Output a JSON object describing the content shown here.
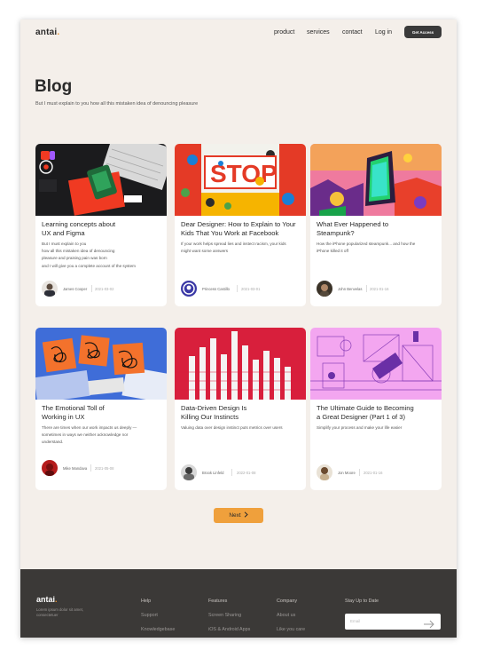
{
  "header": {
    "logo": "antai",
    "logo_dot": ".",
    "nav": [
      "product",
      "services",
      "contact",
      "Log in"
    ],
    "cta": "Get Access"
  },
  "hero": {
    "title": "Blog",
    "subtitle": "But I must explain to you how all this mistaken idea of denouncing pleasure"
  },
  "posts": [
    {
      "title_lines": [
        "Learning concepts about",
        "UX and Figma"
      ],
      "excerpt_lines": [
        "But I must explain to you",
        "how all this mistaken idea of denouncing",
        "pleasure and praising pain was born",
        "and I will give you a complete account of the system"
      ],
      "author": "James Cooper",
      "date": "2021-03-02"
    },
    {
      "title_lines": [
        "Dear Designer: How to Explain to Your",
        "Kids That You Work at Facebook"
      ],
      "excerpt_lines": [
        "If your work helps spread lies and instect racism, your kids",
        "might want some answers"
      ],
      "author": "Princess Castillo",
      "date": "2021-03-01"
    },
    {
      "title_lines": [
        "What Ever Happened to",
        "Steampunk?"
      ],
      "excerpt_lines": [
        "How the iPhone popularized steampunk... and how the",
        "iPhone killed it off"
      ],
      "author": "John Benvelas",
      "date": "2021-01-16"
    },
    {
      "title_lines": [
        "The Emotional Toll of",
        "Working in UX"
      ],
      "excerpt_lines": [
        "There are times when our work impacts us deeply —",
        "sometimes in ways we neither acknowledge nor",
        "understand."
      ],
      "author": "Mike Mandava",
      "date": "2021-05-08"
    },
    {
      "title_lines": [
        "Data-Driven Design Is",
        "Killing Our Instincts"
      ],
      "excerpt_lines": [
        "Valuing data over design instinct puts metrics over users"
      ],
      "author": "Brook Linfeld",
      "date": "2022-01-08"
    },
    {
      "title_lines": [
        "The Ultimate Guide to Becoming",
        "a Great Designer (Part 1 of 3)"
      ],
      "excerpt_lines": [
        "Simplify your process and make your life easier"
      ],
      "author": "Jon Moore",
      "date": "2021-01-16"
    }
  ],
  "pagination": {
    "next_label": "Next",
    "next_icon": "chevron-right-icon"
  },
  "footer": {
    "logo": "antai",
    "tagline": "Lorem ipsum dolor sit amet, consectetuer",
    "columns": [
      {
        "heading": "Help",
        "links": [
          "Support",
          "Knowledgebase"
        ]
      },
      {
        "heading": "Features",
        "links": [
          "Screen Sharing",
          "iOS & Android Apps"
        ]
      },
      {
        "heading": "Company",
        "links": [
          "About us",
          "Like you care"
        ]
      }
    ],
    "newsletter": {
      "heading": "Stay Up to Date",
      "placeholder": "Email",
      "submit_icon": "arrow-right-icon"
    }
  },
  "colors": {
    "page_bg": "#f4efea",
    "accent": "#efa03c",
    "dark": "#3a3a3a",
    "footer_bg": "#3b3937"
  }
}
